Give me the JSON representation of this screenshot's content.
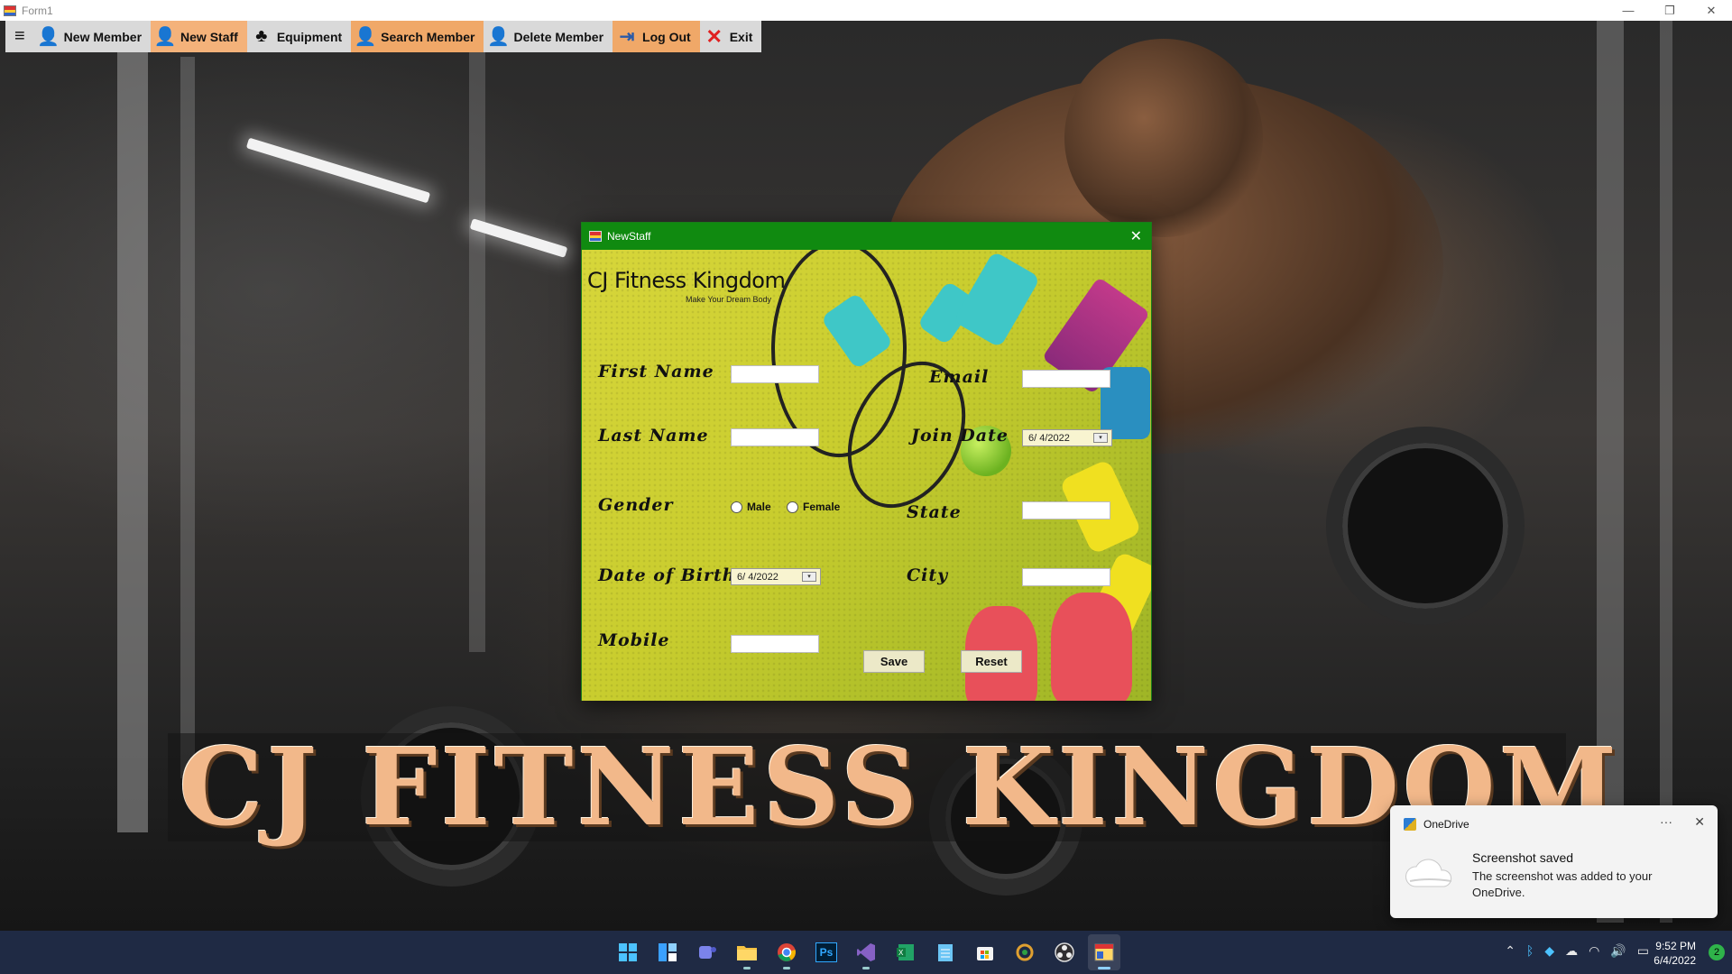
{
  "window": {
    "title": "Form1",
    "controls": {
      "minimize": "—",
      "restore": "❐",
      "close": "✕"
    }
  },
  "menu": {
    "hamburger": "≡",
    "items": [
      {
        "label": "New Member",
        "icon": "add-user-icon"
      },
      {
        "label": "New Staff",
        "icon": "staff-icon"
      },
      {
        "label": "Equipment",
        "icon": "equipment-icon"
      },
      {
        "label": "Search Member",
        "icon": "search-user-icon"
      },
      {
        "label": "Delete Member",
        "icon": "delete-user-icon"
      },
      {
        "label": "Log Out",
        "icon": "logout-icon"
      },
      {
        "label": "Exit",
        "icon": "close-icon"
      }
    ]
  },
  "background": {
    "banner": "CJ FITNESS KINGDOM"
  },
  "dialog": {
    "title": "NewStaff",
    "close": "✕",
    "brand": "CJ Fitness Kingdom",
    "brand_sub": "Make Your Dream Body",
    "labels": {
      "first_name": "First Name",
      "last_name": "Last Name",
      "gender": "Gender",
      "dob": "Date of Birth",
      "mobile": "Mobile",
      "email": "Email",
      "join_date": "Join Date",
      "state": "State",
      "city": "City"
    },
    "fields": {
      "first_name": "",
      "last_name": "",
      "mobile": "",
      "email": "",
      "state": "",
      "city": ""
    },
    "gender_options": {
      "male": "Male",
      "female": "Female"
    },
    "dob_value": "6/ 4/2022",
    "join_date_value": "6/ 4/2022",
    "save": "Save",
    "reset": "Reset"
  },
  "toast": {
    "app": "OneDrive",
    "more": "···",
    "close": "✕",
    "title": "Screenshot saved",
    "body": "The screenshot was added to your OneDrive."
  },
  "taskbar": {
    "apps": [
      "start-icon",
      "widgets-icon",
      "teams-icon",
      "file-explorer-icon",
      "chrome-icon",
      "photoshop-icon",
      "visual-studio-icon",
      "excel-icon",
      "notepad-icon",
      "store-icon",
      "snip-icon",
      "obs-icon",
      "form-app-icon"
    ],
    "photoshop_label": "Ps",
    "time": "9:52 PM",
    "date": "6/4/2022",
    "notifications": "2"
  },
  "colors": {
    "title_green": "#108a10",
    "menu_active": "#f4b27a",
    "banner": "#f2b88a",
    "taskbar": "#1f2a44"
  }
}
